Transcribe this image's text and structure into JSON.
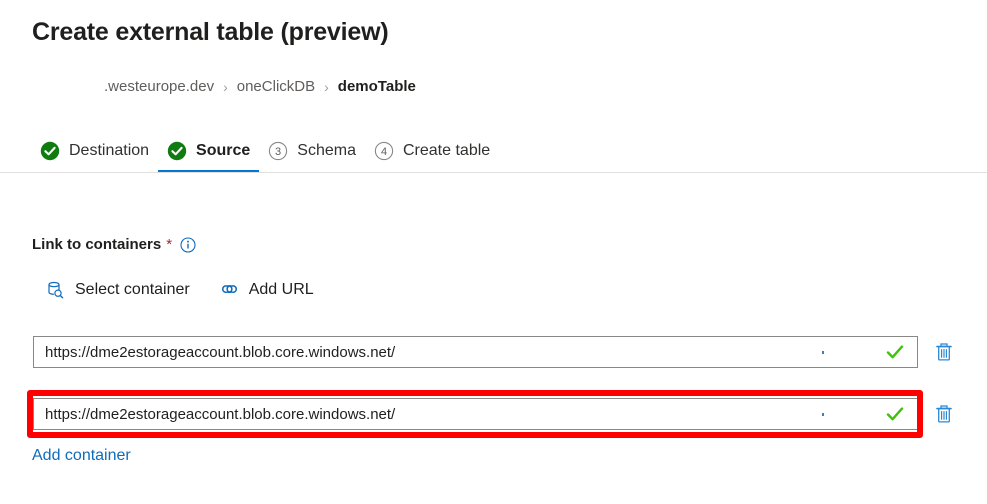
{
  "page": {
    "title": "Create external table (preview)"
  },
  "breadcrumb": {
    "separator": "›",
    "items": [
      {
        "label": ".westeurope.dev",
        "current": false
      },
      {
        "label": "oneClickDB",
        "current": false
      },
      {
        "label": "demoTable",
        "current": true
      }
    ]
  },
  "steps": [
    {
      "label": "Destination",
      "state": "complete",
      "number": "1",
      "icon": "check-circle-icon",
      "active": false
    },
    {
      "label": "Source",
      "state": "complete",
      "number": "2",
      "icon": "check-circle-icon",
      "active": true
    },
    {
      "label": "Schema",
      "state": "pending",
      "number": "3",
      "icon": "number-circle-icon",
      "active": false
    },
    {
      "label": "Create table",
      "state": "pending",
      "number": "4",
      "icon": "number-circle-icon",
      "active": false
    }
  ],
  "form": {
    "label": "Link to containers",
    "required_marker": "*",
    "info_icon": "info-icon"
  },
  "commands": [
    {
      "label": "Select container",
      "icon": "container-search-icon"
    },
    {
      "label": "Add URL",
      "icon": "link-icon"
    }
  ],
  "containers": [
    {
      "url": "https://dme2estorageaccount.blob.core.windows.net/",
      "status": "valid",
      "status_icon": "green-check-icon",
      "delete_icon": "trash-icon",
      "highlighted": false
    },
    {
      "url": "https://dme2estorageaccount.blob.core.windows.net/",
      "status": "valid",
      "status_icon": "green-check-icon",
      "delete_icon": "trash-icon",
      "highlighted": true
    }
  ],
  "links": {
    "add_container": "Add container"
  },
  "colors": {
    "accent": "#0078d4",
    "link": "#0f6cbd",
    "success": "#107c10",
    "valid_check": "#3fc20a",
    "required": "#a4262c",
    "annotation": "#ff0000",
    "icon_blue": "#0f6cbd"
  }
}
